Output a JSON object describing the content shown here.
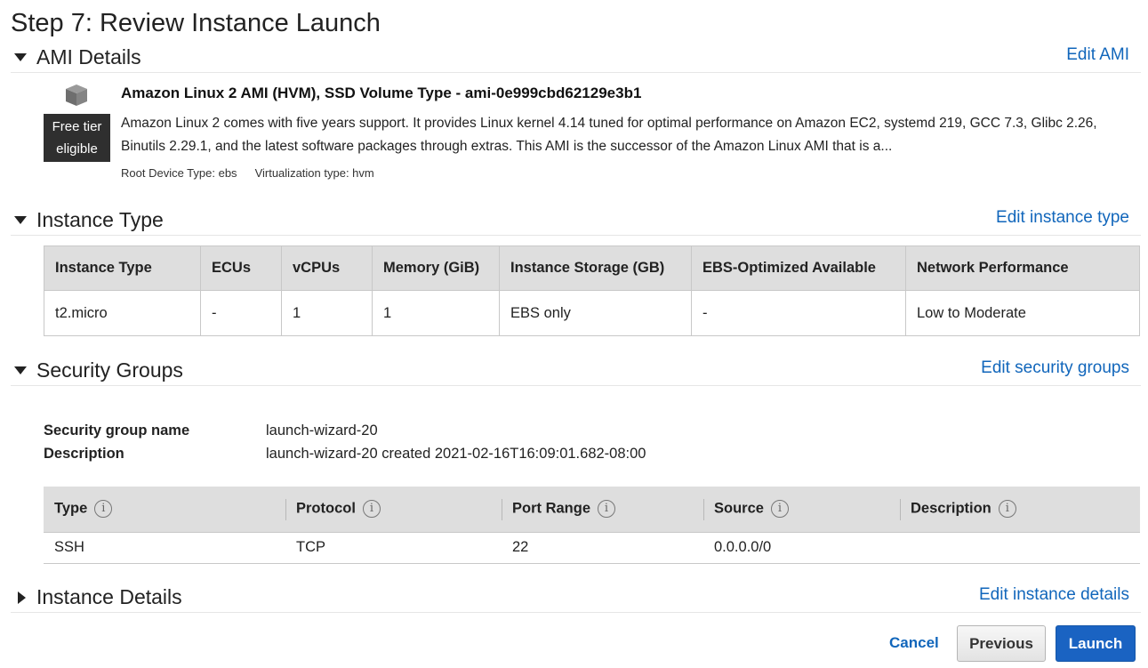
{
  "page_title": "Step 7: Review Instance Launch",
  "ami_section": {
    "title": "AMI Details",
    "edit_link": "Edit AMI",
    "icon": "cube-icon",
    "badge_line1": "Free tier",
    "badge_line2": "eligible",
    "name": "Amazon Linux 2 AMI (HVM), SSD Volume Type - ami-0e999cbd62129e3b1",
    "description": "Amazon Linux 2 comes with five years support. It provides Linux kernel 4.14 tuned for optimal performance on Amazon EC2, systemd 219, GCC 7.3, Glibc 2.26, Binutils 2.29.1, and the latest software packages through extras. This AMI is the successor of the Amazon Linux AMI that is a...",
    "root_device": "Root Device Type: ebs",
    "virtualization": "Virtualization type: hvm"
  },
  "instance_type_section": {
    "title": "Instance Type",
    "edit_link": "Edit instance type",
    "headers": [
      "Instance Type",
      "ECUs",
      "vCPUs",
      "Memory (GiB)",
      "Instance Storage (GB)",
      "EBS-Optimized Available",
      "Network Performance"
    ],
    "row": [
      "t2.micro",
      "-",
      "1",
      "1",
      "EBS only",
      "-",
      "Low to Moderate"
    ]
  },
  "security_groups_section": {
    "title": "Security Groups",
    "edit_link": "Edit security groups",
    "name_label": "Security group name",
    "name_value": "launch-wizard-20",
    "desc_label": "Description",
    "desc_value": "launch-wizard-20 created 2021-02-16T16:09:01.682-08:00",
    "headers": [
      "Type",
      "Protocol",
      "Port Range",
      "Source",
      "Description"
    ],
    "info_glyph": "i",
    "rows": [
      [
        "SSH",
        "TCP",
        "22",
        "0.0.0.0/0",
        ""
      ]
    ]
  },
  "instance_details_section": {
    "title": "Instance Details",
    "edit_link": "Edit instance details"
  },
  "footer": {
    "cancel": "Cancel",
    "previous": "Previous",
    "launch": "Launch"
  },
  "colors": {
    "link": "#1166bb",
    "launch_button": "#1a63c2",
    "table_header": "#dedede",
    "badge": "#2f2f2f"
  }
}
